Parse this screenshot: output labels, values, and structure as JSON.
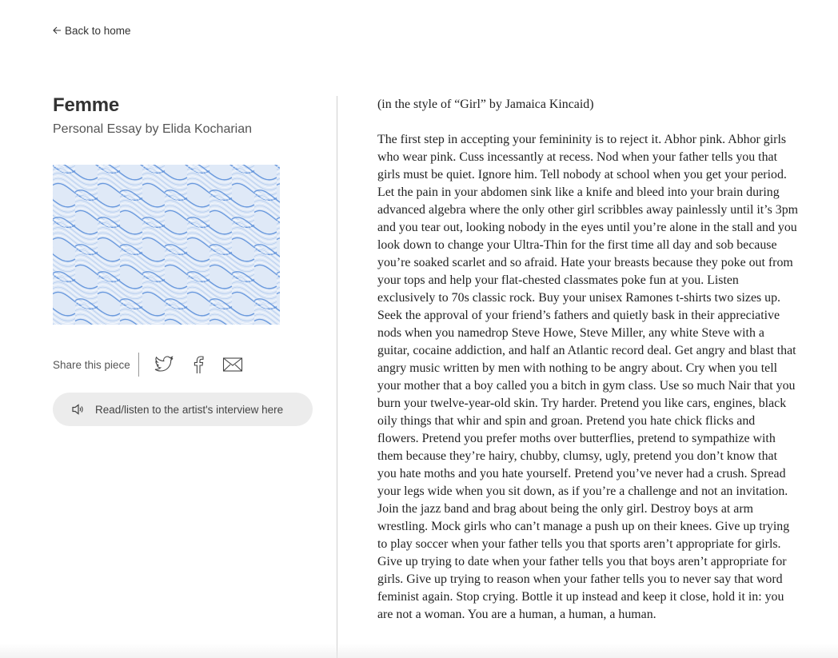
{
  "nav": {
    "back_label": "Back to home"
  },
  "article": {
    "title": "Femme",
    "subtitle": "Personal Essay by Elida Kocharian"
  },
  "share": {
    "label": "Share this piece",
    "icons": [
      "twitter-icon",
      "facebook-icon",
      "mail-icon"
    ]
  },
  "listen_button": {
    "label": "Read/listen to the artist's interview here",
    "icon": "speaker-icon"
  },
  "artwork": {
    "colors": {
      "background": "#dfe9f7",
      "line": "#5b8fd9",
      "highlight": "#ffffff"
    }
  },
  "essay": {
    "intro": "(in the style of “Girl” by Jamaica Kincaid)",
    "body": "The first step in accepting your femininity is to reject it. Abhor pink. Abhor girls who wear pink. Cuss incessantly at recess. Nod when your father tells you that girls must be quiet. Ignore him. Tell nobody at school when you get your period. Let the pain in your abdomen sink like a knife and bleed into your brain during advanced algebra where the only other girl scribbles away painlessly until it’s 3pm and you tear out, looking nobody in the eyes until you’re alone in the stall and you look down to change your Ultra-Thin for the first time all day and sob because you’re soaked scarlet and so afraid. Hate your breasts because they poke out from your tops and help your flat-chested classmates poke fun at you. Listen exclusively to 70s classic rock. Buy your unisex Ramones t-shirts two sizes up. Seek the approval of your friend’s fathers and quietly bask in their appreciative nods when you namedrop Steve Howe, Steve Miller, any white Steve with a guitar, cocaine addiction, and half an Atlantic record deal. Get angry and blast that angry music written by men with nothing to be angry about. Cry when you tell your mother that a boy called you a bitch in gym class. Use so much Nair that you burn your twelve-year-old skin. Try harder. Pretend you like cars, engines, black oily things that whir and spin and groan. Pretend you hate chick flicks and flowers. Pretend you prefer moths over butterflies, pretend to sympathize with them because they’re hairy, chubby, clumsy, ugly, pretend you don’t know that you hate moths and you hate yourself. Pretend you’ve never had a crush. Spread your legs wide when you sit down, as if you’re a challenge and not an invitation. Join the jazz band and brag about being the only girl. Destroy boys at arm wrestling. Mock girls who can’t manage a push up on their knees. Give up trying to play soccer when your father tells you that sports aren’t appropriate for girls. Give up trying to date when your father tells you that boys aren’t appropriate for girls. Give up trying to reason when your father tells you to never say that word feminist again. Stop crying. Bottle it up instead and keep it close, hold it in: you are not a woman. You are a human, a human, a human."
  }
}
